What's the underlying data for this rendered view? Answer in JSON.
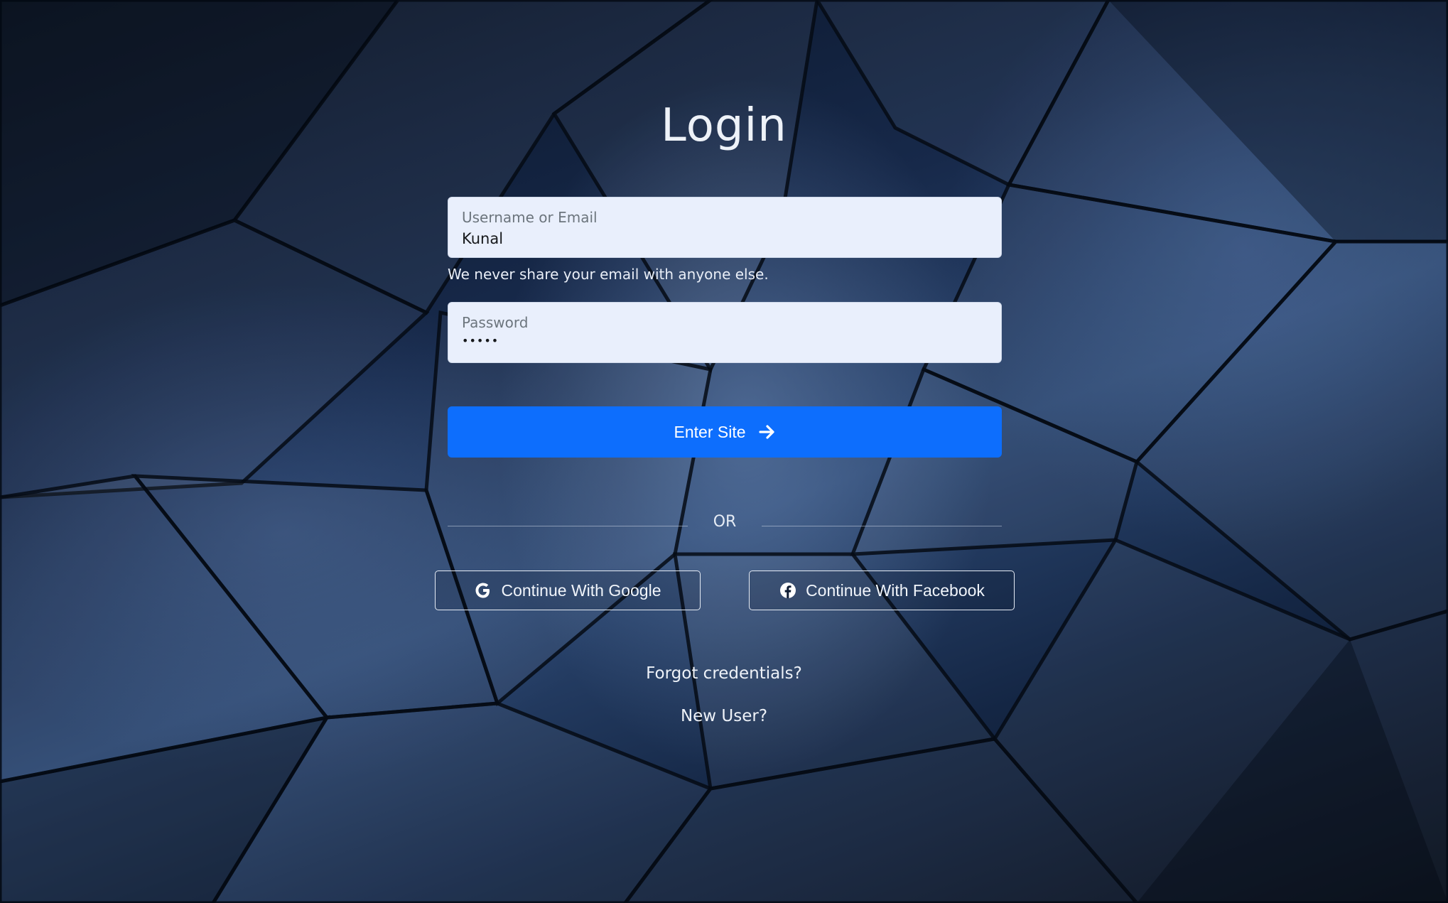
{
  "page": {
    "title": "Login"
  },
  "form": {
    "username": {
      "label": "Username or Email",
      "value": "Kunal"
    },
    "helper_text": "We never share your email with anyone else.",
    "password": {
      "label": "Password",
      "value": "•••••"
    },
    "submit_label": "Enter Site",
    "divider_text": "OR"
  },
  "social": {
    "google_label": "Continue With Google",
    "facebook_label": "Continue With Facebook"
  },
  "links": {
    "forgot": "Forgot credentials?",
    "new_user": "New User?"
  },
  "colors": {
    "primary": "#0d6efd",
    "input_bg": "#e9effc",
    "background": "#1a2c4a"
  },
  "icons": {
    "submit": "arrow-right-icon",
    "google": "google-icon",
    "facebook": "facebook-icon"
  }
}
